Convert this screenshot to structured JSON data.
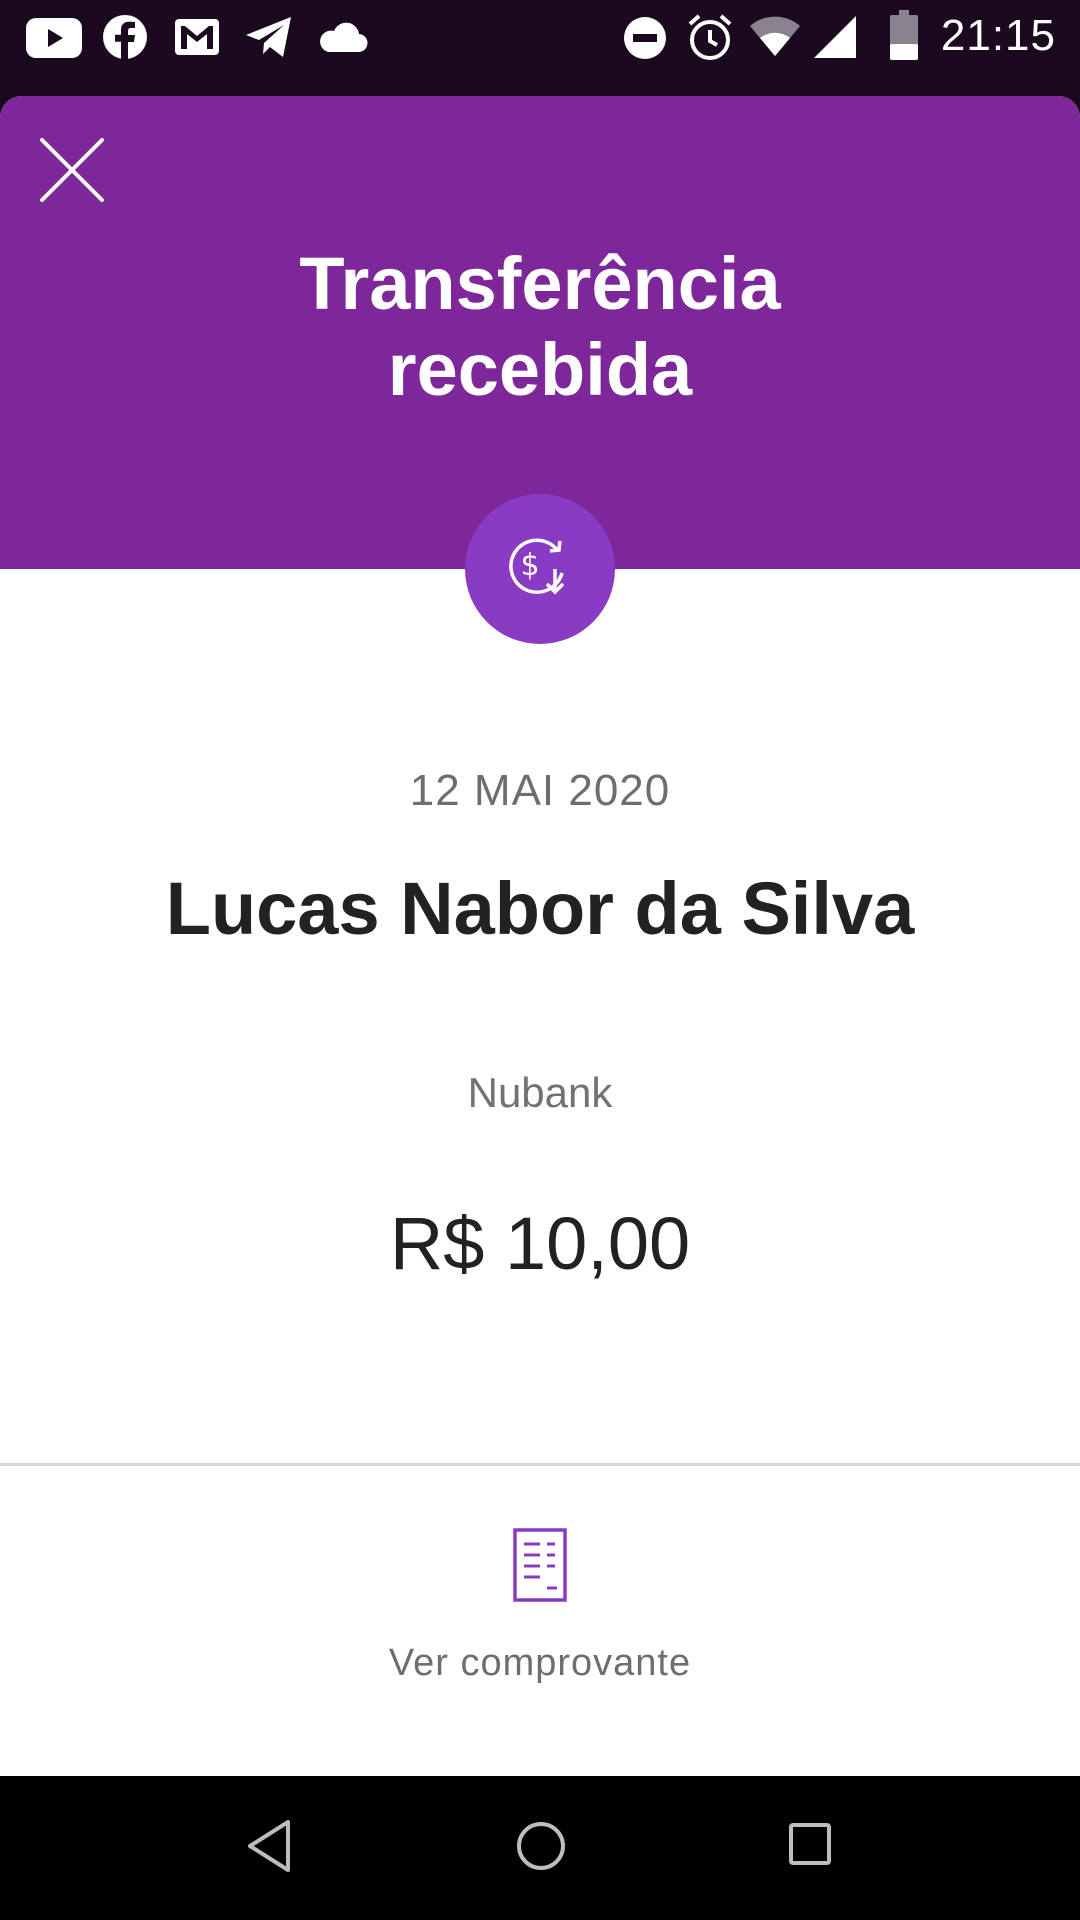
{
  "status_bar": {
    "time": "21:15",
    "left_icons": [
      "youtube-icon",
      "facebook-icon",
      "gmail-icon",
      "telegram-icon",
      "cloud-icon"
    ],
    "right_icons": [
      "do-not-disturb-icon",
      "alarm-icon",
      "wifi-icon",
      "signal-icon",
      "battery-icon"
    ]
  },
  "header": {
    "title_line1": "Transferência",
    "title_line2": "recebida",
    "close_icon": "close-icon",
    "badge_icon": "money-received-icon",
    "accent_color": "#7e279a"
  },
  "transfer": {
    "date": "12 MAI 2020",
    "sender_name": "Lucas Nabor da Silva",
    "bank": "Nubank",
    "amount": "R$ 10,00"
  },
  "receipt": {
    "icon": "receipt-icon",
    "label": "Ver comprovante"
  },
  "nav_bar": {
    "buttons": [
      "back-icon",
      "home-icon",
      "recents-icon"
    ]
  }
}
